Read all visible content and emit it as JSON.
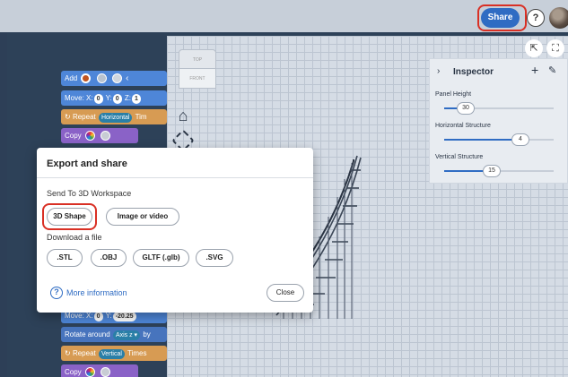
{
  "topbar": {
    "share_label": "Share",
    "help_label": "?"
  },
  "viewcube": {
    "top_label": "TOP",
    "front_label": "FRONT"
  },
  "blocks": {
    "add_label": "Add",
    "move_label": "Move:",
    "x_label": "X:",
    "x_value": "0",
    "y_label": "Y:",
    "y_value": "0",
    "z_label": "Z:",
    "z_value": "1",
    "repeat_label": "Repeat",
    "horizontal_label": "Horizontal",
    "times_short": "Tim",
    "copy_label": "Copy",
    "move2_label": "Move:",
    "x2_value": "0",
    "y2_value": "-20.25",
    "rotate_label": "Rotate around",
    "axis_label": "Axis z ▾",
    "by_label": "by",
    "repeat2_label": "Repeat",
    "vertical_label": "Vertical",
    "times_label": "Times",
    "copy2_label": "Copy"
  },
  "inspector": {
    "title": "Inspector",
    "rows": [
      {
        "label": "Panel Height",
        "value": "30",
        "fraction": 0.18
      },
      {
        "label": "Horizontal Structure",
        "value": "4",
        "fraction": 0.68
      },
      {
        "label": "Vertical Structure",
        "value": "15",
        "fraction": 0.42
      }
    ]
  },
  "dialog": {
    "title": "Export and share",
    "section_send": "Send To 3D Workspace",
    "btn_3d_shape": "3D Shape",
    "btn_image_video": "Image or video",
    "section_download": "Download a file",
    "btn_stl": ".STL",
    "btn_obj": ".OBJ",
    "btn_gltf": "GLTF (.glb)",
    "btn_svg": ".SVG",
    "more_info": "More information",
    "close_label": "Close"
  },
  "colors": {
    "accent": "#2f6cc3",
    "highlight": "#d93025"
  }
}
